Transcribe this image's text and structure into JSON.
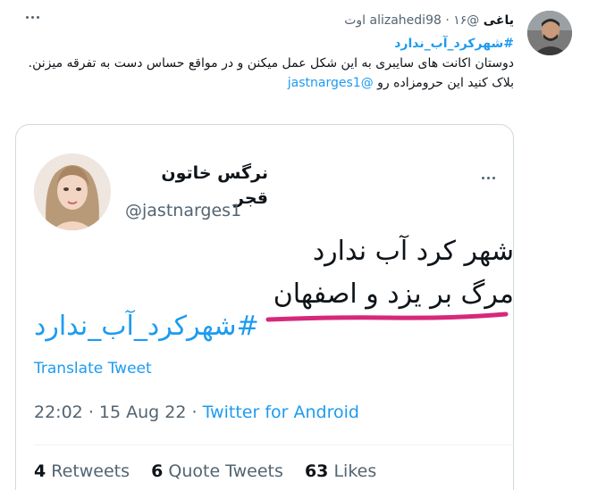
{
  "tweet": {
    "display_name": "یاغی",
    "handle": "@alizahedi98",
    "separator": "·",
    "date": "۱۶ اوت",
    "hashtag": "#شهرکرد_آب_ندارد",
    "body_line_1": "دوستان اکانت های سایبری به این شکل عمل میکنن و در مواقع حساس دست به تفرقه میزنن.",
    "body_line_2_prefix": "بلاک کنید این حرومزاده رو",
    "mention": "@jastnarges1"
  },
  "quote": {
    "display_name": "نرگس خاتون قجر",
    "handle": "@jastnarges1",
    "text_line_1": "شهر کرد آب ندارد",
    "text_line_2": "مرگ بر یزد و اصفهان",
    "hashtag": "#شهرکرد_آب_ندارد",
    "translate_label": "Translate Tweet",
    "time": "22:02",
    "sep1": "·",
    "date": "15 Aug 22",
    "sep2": "·",
    "source": "Twitter for Android",
    "retweets_count": "4",
    "retweets_label": "Retweets",
    "quotes_count": "6",
    "quotes_label": "Quote Tweets",
    "likes_count": "63",
    "likes_label": "Likes"
  },
  "icons": {
    "more": "more-horizontal-icon",
    "avatar": "user-avatar",
    "underline": "red-marker-underline"
  },
  "colors": {
    "link": "#1d9bf0",
    "text": "#0f1419",
    "muted": "#536471",
    "border": "#cfd9de",
    "marker": "#d6287a"
  }
}
